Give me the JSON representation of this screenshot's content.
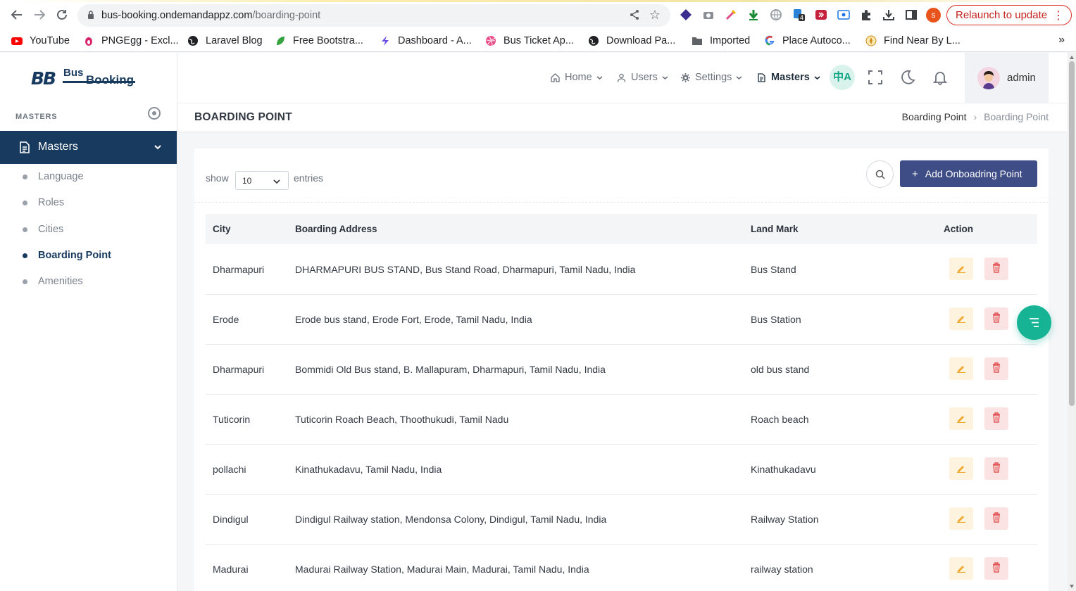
{
  "browser": {
    "url_host": "bus-booking.ondemandappz.com",
    "url_path": "/boarding-point",
    "relaunch_label": "Relaunch to update",
    "profile_initial": "s",
    "extension_badge": "4",
    "bookmarks": [
      {
        "label": "YouTube",
        "icon": "youtube-icon"
      },
      {
        "label": "PNGEgg - Excl...",
        "icon": "pngegg-icon"
      },
      {
        "label": "Laravel Blog",
        "icon": "globe-icon"
      },
      {
        "label": "Free Bootstra...",
        "icon": "leaf-icon"
      },
      {
        "label": "Dashboard - A...",
        "icon": "bolt-icon"
      },
      {
        "label": "Bus Ticket Ap...",
        "icon": "dribbble-icon"
      },
      {
        "label": "Download Pa...",
        "icon": "globe-icon"
      },
      {
        "label": "Imported",
        "icon": "folder-icon"
      },
      {
        "label": "Place Autoco...",
        "icon": "google-icon"
      },
      {
        "label": "Find Near By L...",
        "icon": "compass-icon"
      }
    ],
    "more_bookmarks": "»"
  },
  "sidebar": {
    "logo_mark": "BB",
    "logo_bus": "Bus",
    "logo_booking": "Booking",
    "caption": "MASTERS",
    "active_group": "Masters",
    "items": [
      {
        "label": "Language"
      },
      {
        "label": "Roles"
      },
      {
        "label": "Cities"
      },
      {
        "label": "Boarding Point"
      },
      {
        "label": "Amenities"
      }
    ]
  },
  "header": {
    "nav": [
      {
        "label": "Home",
        "icon": "home-icon"
      },
      {
        "label": "Users",
        "icon": "user-icon"
      },
      {
        "label": "Settings",
        "icon": "gear-icon"
      },
      {
        "label": "Masters",
        "icon": "document-icon"
      }
    ],
    "translate_glyph": "中A",
    "user_name": "admin"
  },
  "page": {
    "title": "BOARDING POINT",
    "breadcrumb": [
      "Boarding Point",
      "Boarding Point"
    ],
    "breadcrumb_sep": "›"
  },
  "list": {
    "show_label": "show",
    "entries_value": "10",
    "entries_label": "entries",
    "add_button": "Add Onboadring Point",
    "columns": [
      "City",
      "Boarding Address",
      "Land Mark",
      "Action"
    ],
    "rows": [
      {
        "city": "Dharmapuri",
        "address": "DHARMAPURI BUS STAND, Bus Stand Road, Dharmapuri, Tamil Nadu, India",
        "landmark": "Bus Stand"
      },
      {
        "city": "Erode",
        "address": "Erode bus stand, Erode Fort, Erode, Tamil Nadu, India",
        "landmark": "Bus Station"
      },
      {
        "city": "Dharmapuri",
        "address": "Bommidi Old Bus stand, B. Mallapuram, Dharmapuri, Tamil Nadu, India",
        "landmark": "old bus stand"
      },
      {
        "city": "Tuticorin",
        "address": "Tuticorin Roach Beach, Thoothukudi, Tamil Nadu",
        "landmark": "Roach beach"
      },
      {
        "city": "pollachi",
        "address": "Kinathukadavu, Tamil Nadu, India",
        "landmark": "Kinathukadavu"
      },
      {
        "city": "Dindigul",
        "address": "Dindigul Railway station, Mendonsa Colony, Dindigul, Tamil Nadu, India",
        "landmark": "Railway Station"
      },
      {
        "city": "Madurai",
        "address": "Madurai Railway Station, Madurai Main, Madurai, Tamil Nadu, India",
        "landmark": "railway station"
      }
    ]
  },
  "colors": {
    "primary_navy": "#173a5e",
    "button_indigo": "#3e4d86",
    "accent_teal": "#16b395",
    "edit_orange": "#f0a92e",
    "delete_red": "#e25555"
  }
}
